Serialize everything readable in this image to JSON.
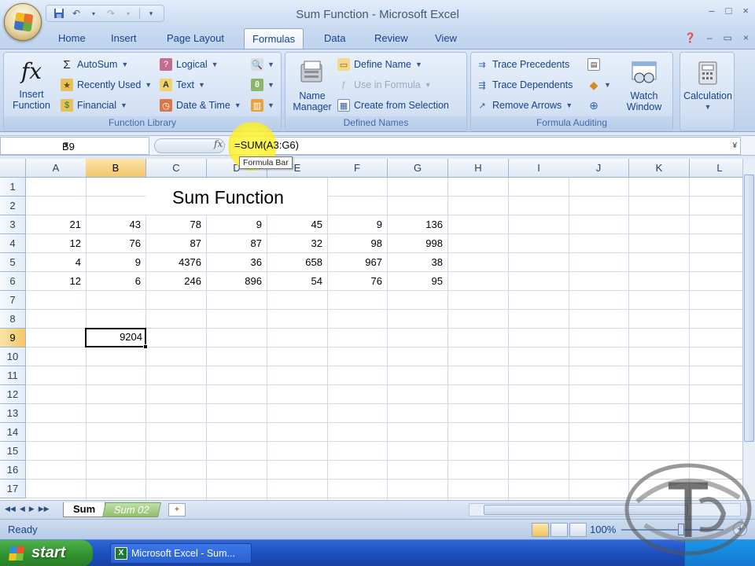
{
  "window": {
    "title": "Sum Function - Microsoft Excel",
    "controls": [
      "–",
      "□",
      "×"
    ]
  },
  "tabs": [
    "Home",
    "Insert",
    "Page Layout",
    "Formulas",
    "Data",
    "Review",
    "View"
  ],
  "active_tab": "Formulas",
  "ribbon": {
    "function_library": {
      "label": "Function Library",
      "insert_function": "Insert\nFunction",
      "autosum": "AutoSum",
      "recently_used": "Recently Used",
      "financial": "Financial",
      "logical": "Logical",
      "text": "Text",
      "date_time": "Date & Time"
    },
    "defined_names": {
      "label": "Defined Names",
      "name_manager": "Name\nManager",
      "define_name": "Define Name",
      "use_in_formula": "Use in Formula",
      "create_from_selection": "Create from Selection"
    },
    "formula_auditing": {
      "label": "Formula Auditing",
      "trace_precedents": "Trace Precedents",
      "trace_dependents": "Trace Dependents",
      "remove_arrows": "Remove Arrows",
      "watch_window": "Watch\nWindow"
    },
    "calculation": {
      "label": "Calculation"
    }
  },
  "formula_bar": {
    "name_box": "B9",
    "formula": "=SUM(A3:G6)",
    "tooltip": "Formula Bar"
  },
  "columns": [
    "A",
    "B",
    "C",
    "D",
    "E",
    "F",
    "G",
    "H",
    "I",
    "J",
    "K",
    "L"
  ],
  "rows": [
    "1",
    "2",
    "3",
    "4",
    "5",
    "6",
    "7",
    "8",
    "9",
    "10",
    "11",
    "12",
    "13",
    "14",
    "15",
    "16",
    "17"
  ],
  "sheet": {
    "title": "Sum Function",
    "data": [
      [
        "21",
        "43",
        "78",
        "9",
        "45",
        "9",
        "136"
      ],
      [
        "12",
        "76",
        "87",
        "87",
        "32",
        "98",
        "998"
      ],
      [
        "4",
        "9",
        "4376",
        "36",
        "658",
        "967",
        "38"
      ],
      [
        "12",
        "6",
        "246",
        "896",
        "54",
        "76",
        "95"
      ]
    ],
    "result": "9204",
    "selected_cell": "B9"
  },
  "sheet_tabs": [
    "Sum",
    "Sum 02"
  ],
  "status": {
    "text": "Ready",
    "zoom": "100%"
  },
  "taskbar": {
    "start": "start",
    "item": "Microsoft Excel - Sum..."
  },
  "colors": {
    "ribbon": "#dae6f6",
    "selection_header": "#f3c66a",
    "highlight": "#fff050",
    "taskbar": "#2a5fd0"
  }
}
